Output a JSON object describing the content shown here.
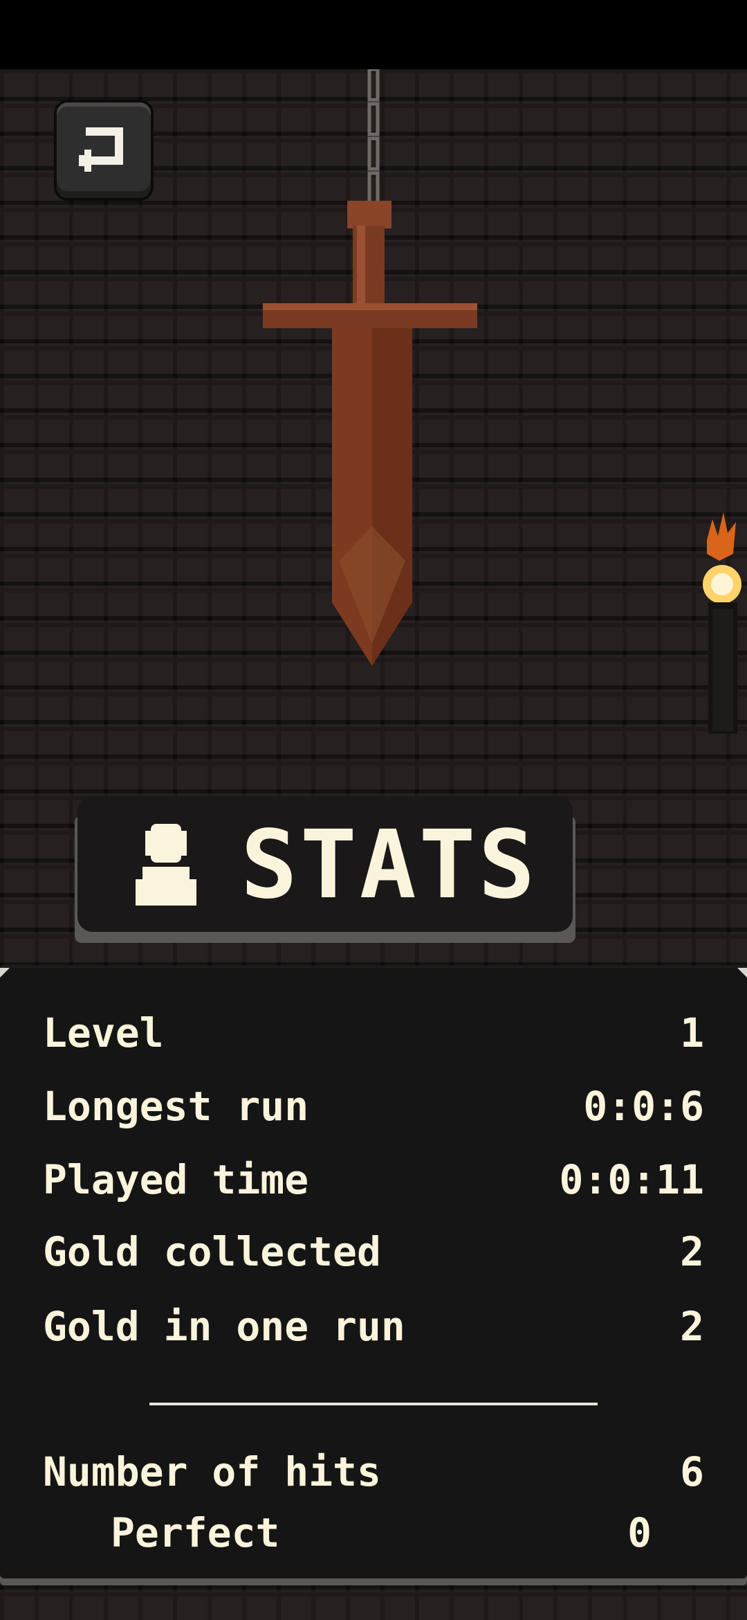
{
  "banner": {
    "title": "STATS",
    "icon": "person-icon"
  },
  "back_button": {
    "icon": "return-arrow-icon"
  },
  "stats": [
    {
      "label": "Level",
      "value": "1"
    },
    {
      "label": "Longest run",
      "value": "0:0:6"
    },
    {
      "label": "Played time",
      "value": "0:0:11"
    },
    {
      "label": "Gold collected",
      "value": "2"
    },
    {
      "label": "Gold in one run",
      "value": "2"
    }
  ],
  "hits": {
    "label": "Number of hits",
    "value": "6",
    "perfect_label": "Perfect",
    "perfect_value": "0"
  },
  "colors": {
    "text": "#fbf4dc",
    "panel": "#161515",
    "wall": "#151212",
    "sword": "#7a3b22"
  }
}
